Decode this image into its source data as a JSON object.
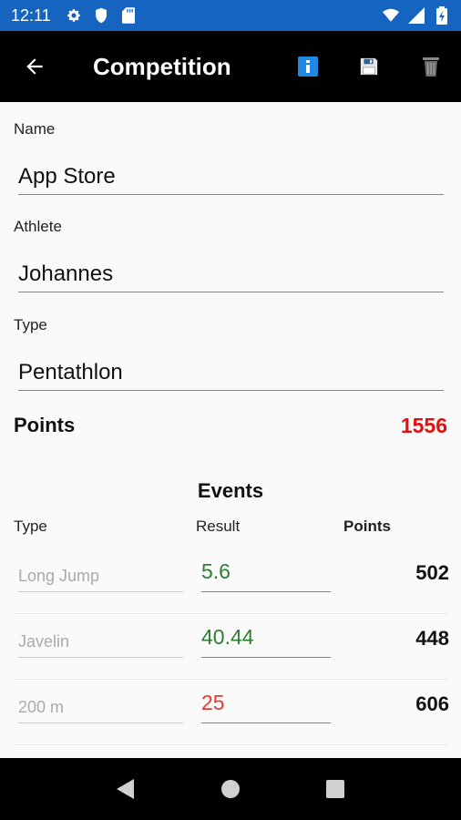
{
  "status_bar": {
    "time": "12:11",
    "icons_left": [
      "gear-icon",
      "shield-icon",
      "sd-card-icon"
    ],
    "icons_right": [
      "wifi-icon",
      "signal-icon",
      "battery-icon"
    ],
    "color": "#1565c0"
  },
  "toolbar": {
    "title": "Competition",
    "actions": [
      "info-icon",
      "save-icon",
      "delete-icon"
    ],
    "info_color": "#1e88e5"
  },
  "form": {
    "name_label": "Name",
    "name_value": "App Store",
    "athlete_label": "Athlete",
    "athlete_value": "Johannes",
    "type_label": "Type",
    "type_value": "Pentathlon"
  },
  "points": {
    "label": "Points",
    "value": "1556",
    "color": "#e41010"
  },
  "events": {
    "title": "Events",
    "headers": {
      "type": "Type",
      "result": "Result",
      "points": "Points"
    },
    "rows": [
      {
        "type": "Long Jump",
        "result": "5.6",
        "result_color": "#2e7d32",
        "points": "502"
      },
      {
        "type": "Javelin",
        "result": "40.44",
        "result_color": "#2e7d32",
        "points": "448"
      },
      {
        "type": "200 m",
        "result": "25",
        "result_color": "#e53935",
        "points": "606"
      }
    ]
  },
  "nav_bar": {
    "buttons": [
      "back-triangle-icon",
      "home-circle-icon",
      "recents-square-icon"
    ]
  }
}
